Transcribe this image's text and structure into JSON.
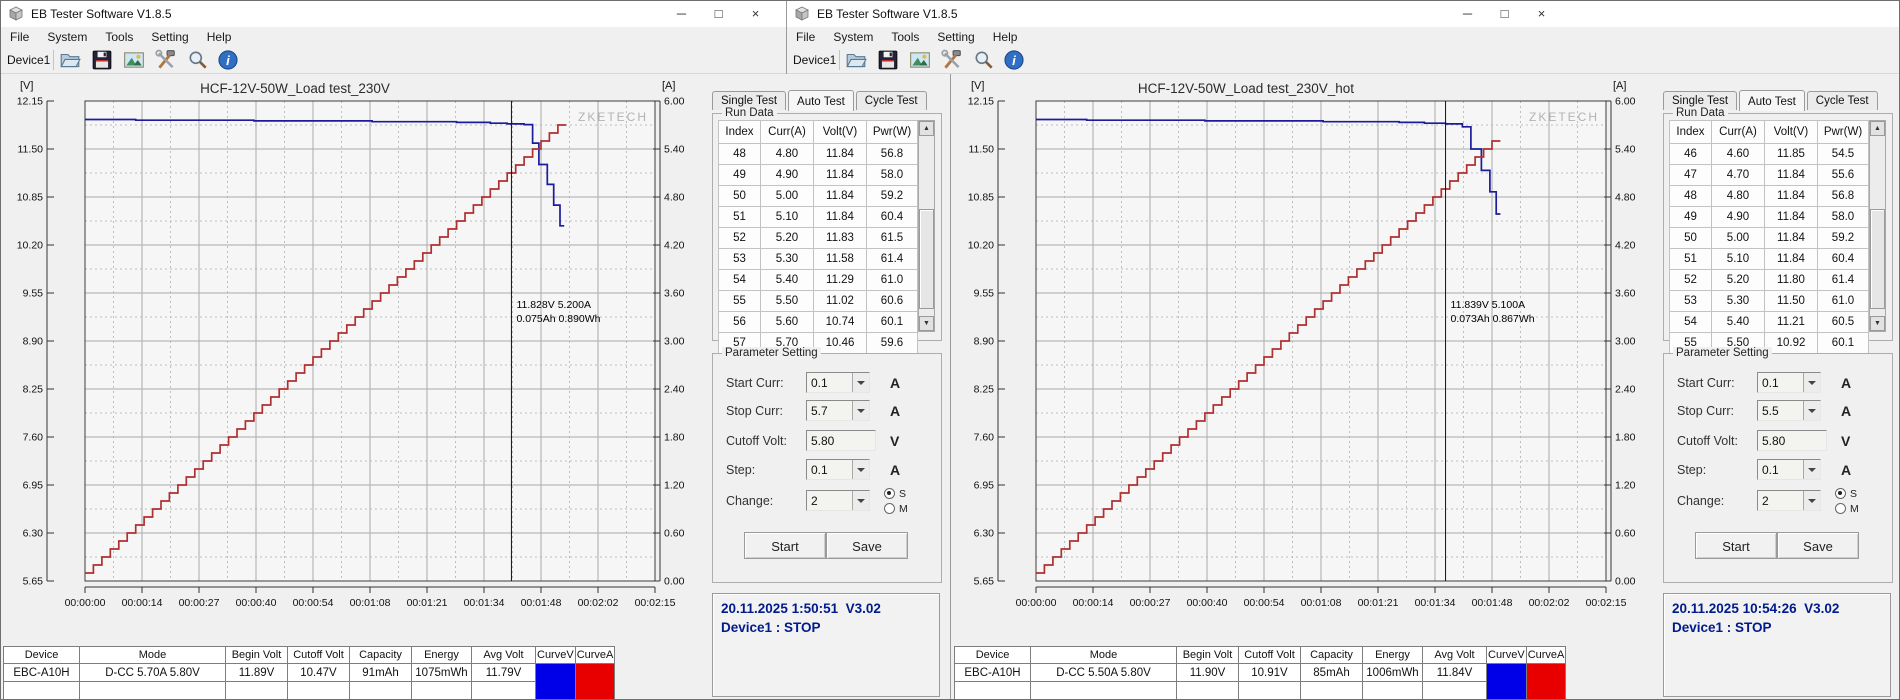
{
  "shared": {
    "window_title": "EB Tester Software V1.8.5",
    "window_controls": {
      "minimize": "─",
      "maximize": "□",
      "close": "×"
    },
    "menus": [
      "File",
      "System",
      "Tools",
      "Setting",
      "Help"
    ],
    "toolbar": {
      "device_label": "Device1",
      "icons": [
        "open-file-icon",
        "save-icon",
        "image-export-icon",
        "settings-tools-icon",
        "zoom-icon",
        "info-icon"
      ]
    },
    "tabs": [
      "Single Test",
      "Auto Test",
      "Cycle Test"
    ],
    "active_tab": "Auto Test",
    "run_data": {
      "group_label": "Run Data",
      "headers": [
        "Index",
        "Curr(A)",
        "Volt(V)",
        "Pwr(W)"
      ]
    },
    "parameter": {
      "group_label": "Parameter Setting",
      "rows": [
        {
          "label": "Start Curr:",
          "unit": "A"
        },
        {
          "label": "Stop Curr:",
          "unit": "A"
        },
        {
          "label": "Cutoff Volt:",
          "unit": "V"
        },
        {
          "label": "Step:",
          "unit": "A"
        },
        {
          "label": "Change:",
          "unit": ""
        }
      ],
      "radio_options": [
        "S",
        "M"
      ],
      "selected_radio": "S",
      "start_button": "Start",
      "save_button": "Save"
    },
    "status_table_headers": [
      "Device",
      "Mode",
      "Begin Volt",
      "Cutoff Volt",
      "Capacity",
      "Energy",
      "Avg Volt",
      "CurveV",
      "CurveA"
    ],
    "colors": {
      "curve_v_swatch": "#0000e8",
      "curve_a_swatch": "#e80000",
      "voltage_line": "#1b1b9e",
      "current_line": "#b03030",
      "status_text": "#001a8c"
    }
  },
  "windows": [
    {
      "name": "left",
      "chart_data": {
        "type": "line",
        "title": "HCF-12V-50W_Load test_230V",
        "watermark": "ZKETECH",
        "x_axis": {
          "ticks": [
            "00:00:00",
            "00:00:14",
            "00:00:27",
            "00:00:40",
            "00:00:54",
            "00:01:08",
            "00:01:21",
            "00:01:34",
            "00:01:48",
            "00:02:02",
            "00:02:15"
          ],
          "max_s": 135
        },
        "y_left": {
          "label": "[V]",
          "min": 5.65,
          "max": 12.15,
          "ticks": [
            "12.15",
            "11.50",
            "10.85",
            "10.20",
            "9.55",
            "8.90",
            "8.25",
            "7.60",
            "6.95",
            "6.30",
            "5.65"
          ]
        },
        "y_right": {
          "label": "[A]",
          "min": 0,
          "max": 6,
          "ticks": [
            "6.00",
            "5.40",
            "4.80",
            "4.20",
            "3.60",
            "3.00",
            "2.40",
            "1.80",
            "1.20",
            "0.60",
            "0.00"
          ]
        },
        "series": [
          {
            "name": "voltage",
            "axis": "left",
            "points": [
              [
                0,
                11.9
              ],
              [
                12,
                11.9
              ],
              [
                12,
                11.89
              ],
              [
                40,
                11.89
              ],
              [
                40,
                11.88
              ],
              [
                68,
                11.88
              ],
              [
                68,
                11.87
              ],
              [
                88,
                11.87
              ],
              [
                88,
                11.86
              ],
              [
                96,
                11.86
              ],
              [
                96,
                11.85
              ],
              [
                100,
                11.85
              ],
              [
                100,
                11.84
              ],
              [
                104,
                11.84
              ],
              [
                104,
                11.83
              ],
              [
                106,
                11.83
              ],
              [
                106,
                11.58
              ],
              [
                107.5,
                11.58
              ],
              [
                107.5,
                11.29
              ],
              [
                109.5,
                11.29
              ],
              [
                109.5,
                11.02
              ],
              [
                111,
                11.02
              ],
              [
                111,
                10.74
              ],
              [
                112.5,
                10.74
              ],
              [
                112.5,
                10.46
              ],
              [
                113.5,
                10.46
              ]
            ]
          },
          {
            "name": "current",
            "axis": "right",
            "step_series": {
              "start": 0.1,
              "increment": 0.1,
              "period_s": 2,
              "count": 57
            }
          }
        ],
        "cursor": {
          "t": 101,
          "line1": "11.828V  5.200A",
          "line2": "0.075Ah 0.890Wh"
        }
      },
      "run_rows": [
        [
          "48",
          "4.80",
          "11.84",
          "56.8"
        ],
        [
          "49",
          "4.90",
          "11.84",
          "58.0"
        ],
        [
          "50",
          "5.00",
          "11.84",
          "59.2"
        ],
        [
          "51",
          "5.10",
          "11.84",
          "60.4"
        ],
        [
          "52",
          "5.20",
          "11.83",
          "61.5"
        ],
        [
          "53",
          "5.30",
          "11.58",
          "61.4"
        ],
        [
          "54",
          "5.40",
          "11.29",
          "61.0"
        ],
        [
          "55",
          "5.50",
          "11.02",
          "60.6"
        ],
        [
          "56",
          "5.60",
          "10.74",
          "60.1"
        ],
        [
          "57",
          "5.70",
          "10.46",
          "59.6"
        ]
      ],
      "params": {
        "start_curr": "0.1",
        "stop_curr": "5.7",
        "cutoff_volt": "5.80",
        "step": "0.1",
        "change": "2"
      },
      "status_values": [
        "EBC-A10H",
        "D-CC 5.70A 5.80V",
        "11.89V",
        "10.47V",
        "91mAh",
        "1075mWh",
        "11.79V"
      ],
      "datetime": "20.11.2025 1:50:51  V3.02",
      "device_state": "Device1 : STOP"
    },
    {
      "name": "right",
      "chart_data": {
        "type": "line",
        "title": "HCF-12V-50W_Load test_230V_hot",
        "watermark": "ZKETECH",
        "x_axis": {
          "ticks": [
            "00:00:00",
            "00:00:14",
            "00:00:27",
            "00:00:40",
            "00:00:54",
            "00:01:08",
            "00:01:21",
            "00:01:34",
            "00:01:48",
            "00:02:02",
            "00:02:15"
          ],
          "max_s": 135
        },
        "y_left": {
          "label": "[V]",
          "min": 5.65,
          "max": 12.15,
          "ticks": [
            "12.15",
            "11.50",
            "10.85",
            "10.20",
            "9.55",
            "8.90",
            "8.25",
            "7.60",
            "6.95",
            "6.30",
            "5.65"
          ]
        },
        "y_right": {
          "label": "[A]",
          "min": 0,
          "max": 6,
          "ticks": [
            "6.00",
            "5.40",
            "4.80",
            "4.20",
            "3.60",
            "3.00",
            "2.40",
            "1.80",
            "1.20",
            "0.60",
            "0.00"
          ]
        },
        "series": [
          {
            "name": "voltage",
            "axis": "left",
            "points": [
              [
                0,
                11.9
              ],
              [
                12,
                11.9
              ],
              [
                12,
                11.89
              ],
              [
                40,
                11.89
              ],
              [
                40,
                11.88
              ],
              [
                68,
                11.88
              ],
              [
                68,
                11.87
              ],
              [
                86,
                11.87
              ],
              [
                86,
                11.86
              ],
              [
                92,
                11.86
              ],
              [
                92,
                11.85
              ],
              [
                97,
                11.85
              ],
              [
                97,
                11.84
              ],
              [
                101,
                11.84
              ],
              [
                101,
                11.8
              ],
              [
                103,
                11.8
              ],
              [
                103,
                11.5
              ],
              [
                105.5,
                11.5
              ],
              [
                105.5,
                11.21
              ],
              [
                107.5,
                11.21
              ],
              [
                107.5,
                10.92
              ],
              [
                109,
                10.92
              ],
              [
                109,
                10.62
              ],
              [
                110,
                10.62
              ]
            ]
          },
          {
            "name": "current",
            "axis": "right",
            "step_series": {
              "start": 0.1,
              "increment": 0.1,
              "period_s": 2,
              "count": 55
            }
          }
        ],
        "cursor": {
          "t": 97,
          "line1": "11.839V  5.100A",
          "line2": "0.073Ah 0.867Wh"
        }
      },
      "run_rows": [
        [
          "46",
          "4.60",
          "11.85",
          "54.5"
        ],
        [
          "47",
          "4.70",
          "11.84",
          "55.6"
        ],
        [
          "48",
          "4.80",
          "11.84",
          "56.8"
        ],
        [
          "49",
          "4.90",
          "11.84",
          "58.0"
        ],
        [
          "50",
          "5.00",
          "11.84",
          "59.2"
        ],
        [
          "51",
          "5.10",
          "11.84",
          "60.4"
        ],
        [
          "52",
          "5.20",
          "11.80",
          "61.4"
        ],
        [
          "53",
          "5.30",
          "11.50",
          "61.0"
        ],
        [
          "54",
          "5.40",
          "11.21",
          "60.5"
        ],
        [
          "55",
          "5.50",
          "10.92",
          "60.1"
        ]
      ],
      "params": {
        "start_curr": "0.1",
        "stop_curr": "5.5",
        "cutoff_volt": "5.80",
        "step": "0.1",
        "change": "2"
      },
      "status_values": [
        "EBC-A10H",
        "D-CC 5.50A 5.80V",
        "11.90V",
        "10.91V",
        "85mAh",
        "1006mWh",
        "11.84V"
      ],
      "datetime": "20.11.2025 10:54:26  V3.02",
      "device_state": "Device1 : STOP"
    }
  ]
}
